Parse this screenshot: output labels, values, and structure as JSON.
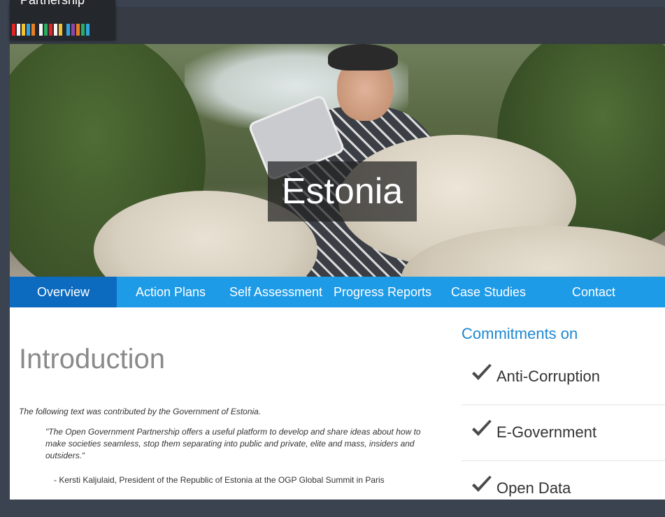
{
  "logo": {
    "text": "Partnership",
    "stripe_colors": [
      "#e02424",
      "#f5f5f5",
      "#f2c230",
      "#2fa5e0",
      "#e67e22",
      "#f5f5f5",
      "#27ae60",
      "#e02424",
      "#f5f5f5",
      "#f2c230",
      "#2fa5e0",
      "#8e44ad",
      "#e67e22",
      "#27ae60",
      "#2fa5e0"
    ]
  },
  "hero": {
    "title": "Estonia"
  },
  "nav": {
    "items": [
      {
        "label": "Overview",
        "active": true
      },
      {
        "label": "Action Plans"
      },
      {
        "label": "Self Assessment"
      },
      {
        "label": "Progress Reports"
      },
      {
        "label": "Case Studies"
      },
      {
        "label": "Contact"
      }
    ]
  },
  "content": {
    "title": "Introduction",
    "note": "The following text was contributed by the Government of Estonia.",
    "quote": "\"The Open Government Partnership offers a useful platform to develop and share ideas about how to make societies seamless, stop them separating into public and private, elite and mass, insiders and outsiders.“",
    "attribution": "- Kersti Kaljulaid, President of the Republic of Estonia at the OGP Global Summit in Paris"
  },
  "sidebar": {
    "title": "Commitments on",
    "items": [
      {
        "label": "Anti-Corruption"
      },
      {
        "label": "E-Government"
      },
      {
        "label": "Open Data"
      }
    ]
  },
  "colors": {
    "nav_bg": "#1e9be7",
    "nav_active": "#0d6bbf",
    "sidebar_title": "#1e88d2"
  }
}
